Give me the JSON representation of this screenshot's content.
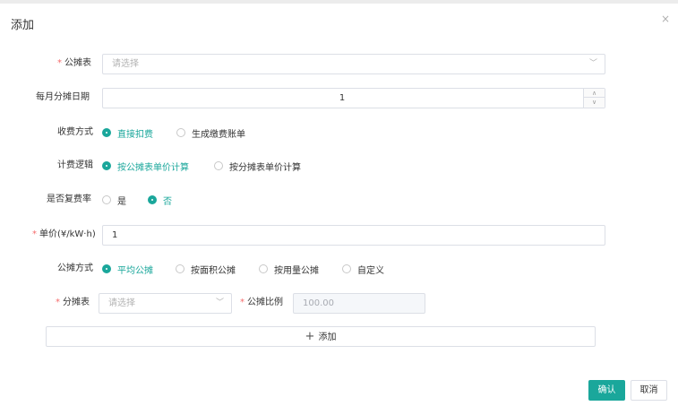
{
  "dialog": {
    "title": "添加",
    "close_icon": "×"
  },
  "form": {
    "allocation_meter": {
      "label": "公摊表",
      "required": true,
      "placeholder": "请选择"
    },
    "monthly_day": {
      "label": "每月分摊日期",
      "value": "1"
    },
    "charge_mode": {
      "label": "收费方式",
      "options": [
        "直接扣费",
        "生成缴费账单"
      ],
      "selected": "直接扣费"
    },
    "billing_logic": {
      "label": "计费逻辑",
      "options": [
        "按公摊表单价计算",
        "按分摊表单价计算"
      ],
      "selected": "按公摊表单价计算"
    },
    "compound_rate": {
      "label": "是否复费率",
      "options": [
        "是",
        "否"
      ],
      "selected": "否"
    },
    "unit_price": {
      "label": "单价(¥/kW·h)",
      "required": true,
      "value": "1"
    },
    "allocation_method": {
      "label": "公摊方式",
      "options": [
        "平均公摊",
        "按面积公摊",
        "按用量公摊",
        "自定义"
      ],
      "selected": "平均公摊"
    },
    "sub_meter": {
      "label": "分摊表",
      "required": true,
      "placeholder": "请选择"
    },
    "allocation_ratio": {
      "label": "公摊比例",
      "required": true,
      "value": "100.00"
    },
    "add_row_label": "添加"
  },
  "footer": {
    "confirm": "确认",
    "cancel": "取消"
  },
  "colors": {
    "accent": "#1aa79b",
    "required_star": "#f56c6c",
    "border": "#dcdfe6"
  },
  "icons": {
    "chevron": "chevron-down-icon",
    "plus": "plus-icon",
    "close": "close-icon"
  }
}
